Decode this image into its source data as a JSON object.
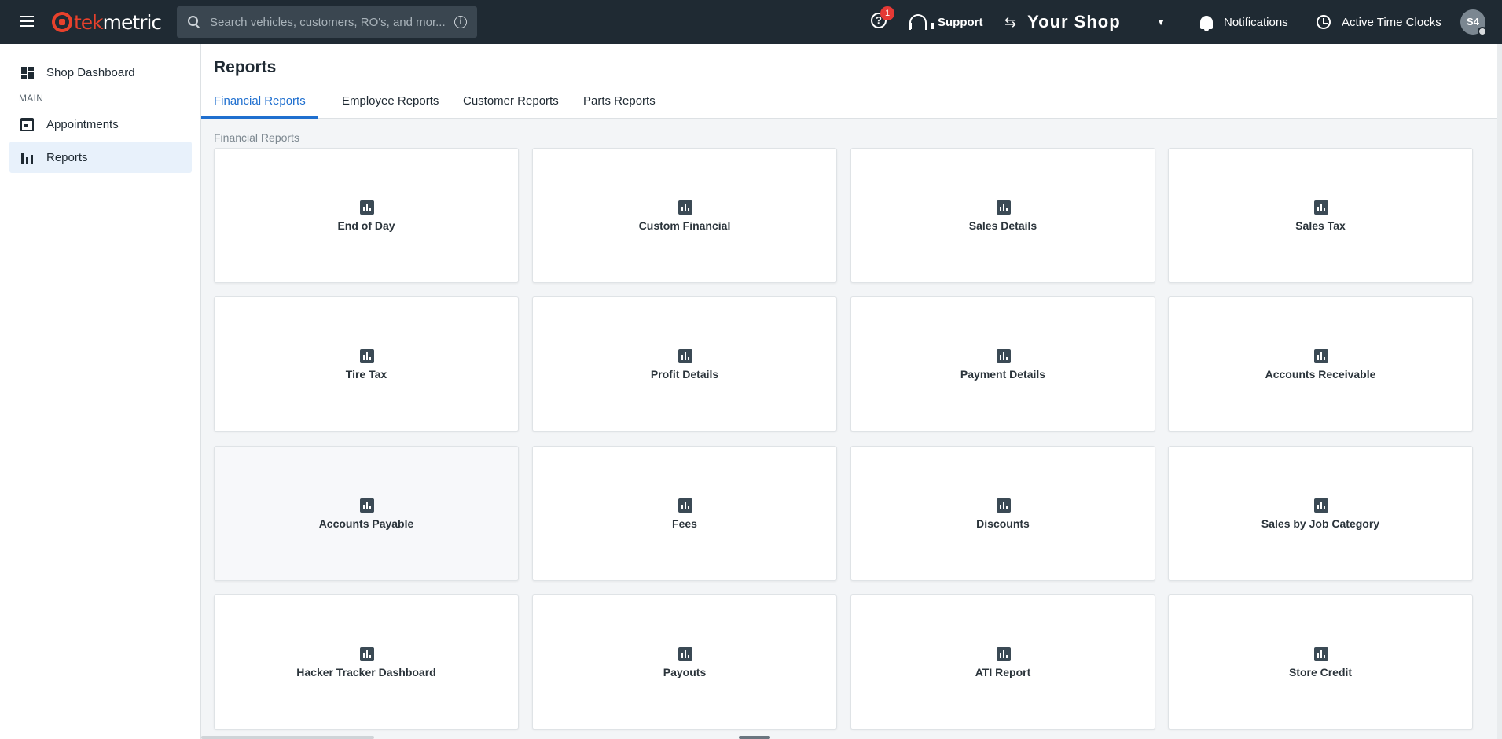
{
  "topbar": {
    "logo_text": "tekmetric",
    "logo_accent": "tek",
    "logo_rest": "metric",
    "search_placeholder": "Search vehicles, customers, RO's, and mor...",
    "help_badge": "1",
    "support_label": "Support",
    "shop_name": "Your Shop",
    "notifications_label": "Notifications",
    "time_clocks_label": "Active Time Clocks",
    "avatar_initials": "S4"
  },
  "sidebar": {
    "dashboard_label": "Shop Dashboard",
    "section_label": "MAIN",
    "items": [
      {
        "label": "Appointments",
        "icon": "calendar-icon"
      },
      {
        "label": "Reports",
        "icon": "bar-chart-icon",
        "active": true
      }
    ]
  },
  "main": {
    "page_title": "Reports",
    "tabs": [
      {
        "label": "Financial Reports",
        "active": true
      },
      {
        "label": "Employee Reports"
      },
      {
        "label": "Customer Reports"
      },
      {
        "label": "Parts Reports"
      }
    ],
    "section_label": "Financial Reports",
    "cards": [
      "End of Day",
      "Custom Financial",
      "Sales Details",
      "Sales Tax",
      "Tire Tax",
      "Profit Details",
      "Payment Details",
      "Accounts Receivable",
      "Accounts Payable",
      "Fees",
      "Discounts",
      "Sales by Job Category",
      "Hacker Tracker Dashboard",
      "Payouts",
      "ATI Report",
      "Store Credit"
    ]
  },
  "colors": {
    "topbar_bg": "#1f2a33",
    "brand_red": "#e8412c",
    "accent_blue": "#1f6fcf",
    "active_nav_bg": "#e8f1fb",
    "badge_red": "#e53935"
  }
}
